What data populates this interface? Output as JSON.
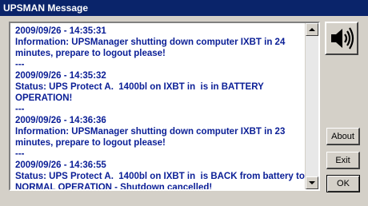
{
  "window": {
    "title": "UPSMAN Message"
  },
  "messages_text": "2009/09/26 - 14:35:31\nInformation: UPSManager shutting down computer IXBT in 24 minutes, prepare to logout please!\n---\n2009/09/26 - 14:35:32\nStatus: UPS Protect A.  1400bl on IXBT in  is in BATTERY OPERATION!\n---\n2009/09/26 - 14:36:36\nInformation: UPSManager shutting down computer IXBT in 23 minutes, prepare to logout please!\n---\n2009/09/26 - 14:36:55\nStatus: UPS Protect A.  1400bl on IXBT in  is BACK from battery to NORMAL OPERATION - Shutdown cancelled!",
  "buttons": {
    "about": "About",
    "exit": "Exit",
    "ok": "OK"
  },
  "icons": {
    "speaker": "speaker-icon"
  }
}
